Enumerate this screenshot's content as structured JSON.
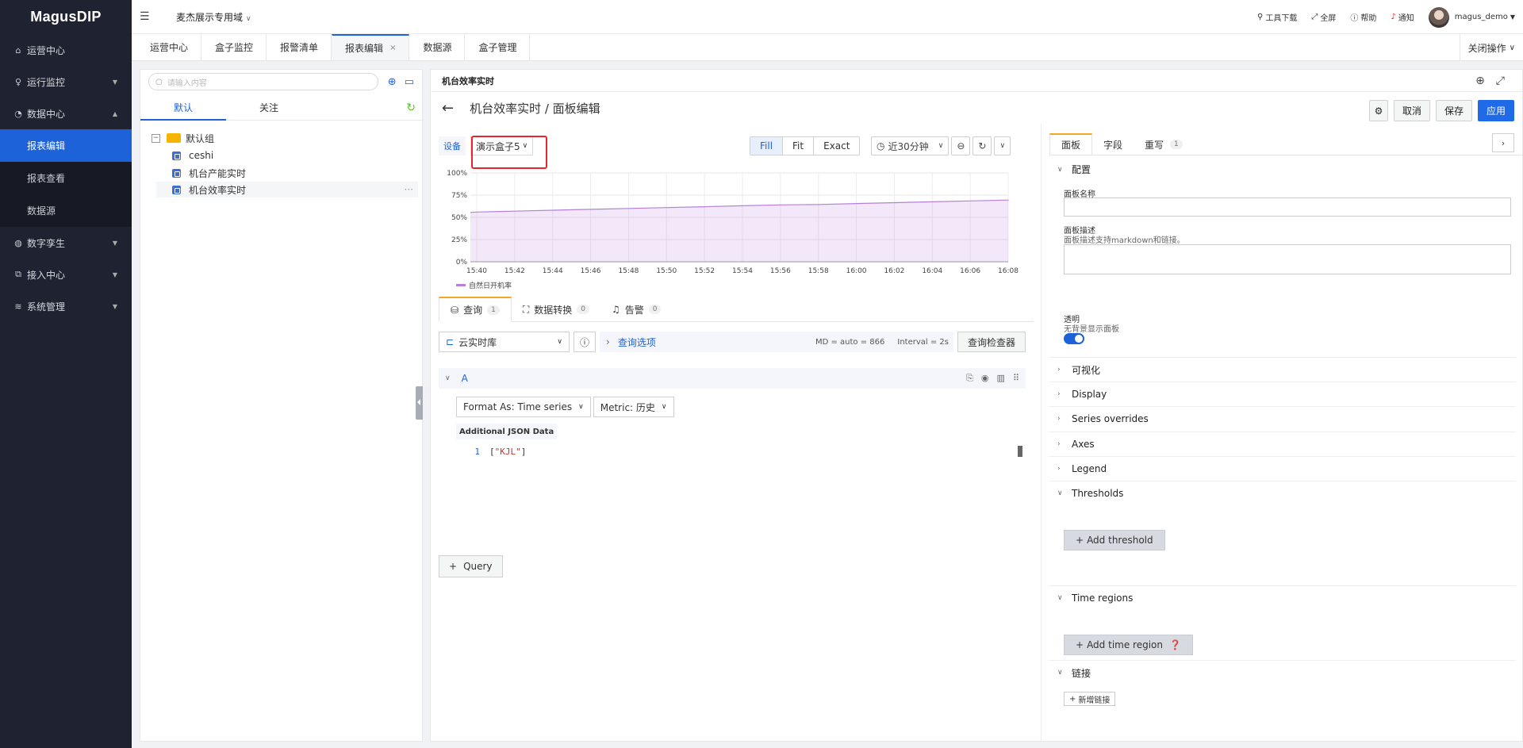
{
  "app": {
    "logo": "MagusDIP",
    "site": "麦杰展示专用域"
  },
  "sidebar": {
    "items": [
      {
        "label": "运营中心",
        "icon": "home-icon"
      },
      {
        "label": "运行监控",
        "icon": "bulb-icon"
      },
      {
        "label": "数据中心",
        "icon": "gauge-icon"
      },
      {
        "label": "数字孪生",
        "icon": "globe-icon"
      },
      {
        "label": "接入中心",
        "icon": "import-icon"
      },
      {
        "label": "系统管理",
        "icon": "layers-icon"
      }
    ],
    "sub": [
      "报表编辑",
      "报表查看",
      "数据源"
    ]
  },
  "tools": {
    "download": "工具下载",
    "fullscreen": "全屏",
    "help": "帮助",
    "notify": "通知",
    "user": "magus_demo"
  },
  "tabs": [
    "运营中心",
    "盒子监控",
    "报警清单",
    "报表编辑",
    "数据源",
    "盒子管理"
  ],
  "close_ops": "关闭操作",
  "tree": {
    "search_placeholder": "请输入内容",
    "tab_default": "默认",
    "tab_follow": "关注",
    "group": "默认组",
    "items": [
      "ceshi",
      "机台产能实时",
      "机台效率实时"
    ],
    "more": "···"
  },
  "panel": {
    "title": "机台效率实时",
    "crumb": "机台效率实时 / 面板编辑",
    "btn_cancel": "取消",
    "btn_save": "保存",
    "btn_apply": "应用"
  },
  "editor": {
    "var_label": "设备",
    "device": "演示盒子5",
    "fit": [
      "Fill",
      "Fit",
      "Exact"
    ],
    "time_range": "近30分钟"
  },
  "chart_data": {
    "type": "area",
    "x": [
      "15:40",
      "15:42",
      "15:44",
      "15:46",
      "15:48",
      "15:50",
      "15:52",
      "15:54",
      "15:56",
      "15:58",
      "16:00",
      "16:02",
      "16:04",
      "16:06",
      "16:08"
    ],
    "series": [
      {
        "name": "自然日开机率",
        "values": [
          56,
          57,
          58,
          59,
          60,
          61,
          62,
          63,
          64,
          64.5,
          65.5,
          66.5,
          67.5,
          68.5,
          69.5
        ],
        "color": "#b67fdb"
      }
    ],
    "yticks": [
      "0%",
      "25%",
      "50%",
      "75%",
      "100%"
    ],
    "ylim": [
      0,
      100
    ],
    "grid": true,
    "legend": "bottom-left"
  },
  "query": {
    "tabs": [
      {
        "label": "查询",
        "count": "1"
      },
      {
        "label": "数据转换",
        "count": "0"
      },
      {
        "label": "告警",
        "count": "0"
      }
    ],
    "datasource": "云实时库",
    "options": "查询选项",
    "md": "MD = auto = 866",
    "interval": "Interval = 2s",
    "inspector": "查询检查器",
    "ref": "A",
    "format": "Format As: Time series",
    "metric": "Metric: 历史",
    "json_label": "Additional JSON Data",
    "line_no": "1",
    "code_open": "[",
    "code_str": "\"KJL\"",
    "code_close": "]",
    "add": "Query"
  },
  "options": {
    "tabs": [
      {
        "label": "面板"
      },
      {
        "label": "字段"
      },
      {
        "label": "重写",
        "count": "1"
      }
    ],
    "config": "配置",
    "name_label": "面板名称",
    "desc_label": "面板描述",
    "desc_hint": "面板描述支持markdown和链接。",
    "transparent_label": "透明",
    "transparent_hint": "无背景显示面板",
    "sections": [
      "可视化",
      "Display",
      "Series overrides",
      "Axes",
      "Legend"
    ],
    "thresholds": "Thresholds",
    "add_threshold": "Add threshold",
    "time_regions": "Time regions",
    "add_time_region": "Add time region",
    "links": "链接",
    "new_link": "新增链接"
  }
}
